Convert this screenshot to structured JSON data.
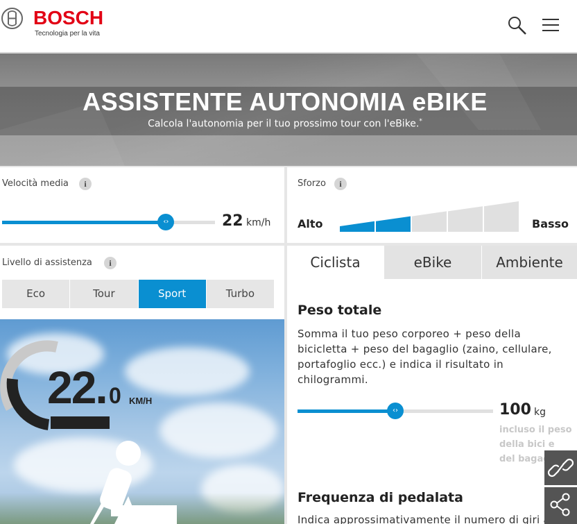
{
  "header": {
    "brand": "BOSCH",
    "tagline": "Tecnologia per la vita",
    "search_icon": "search-icon",
    "menu_icon": "menu-icon"
  },
  "hero": {
    "title": "ASSISTENTE AUTONOMIA eBIKE",
    "subtitle": "Calcola l'autonomia per il tuo prossimo tour con l'eBike.",
    "footnote_mark": "*"
  },
  "speed": {
    "label": "Velocità media",
    "value": "22",
    "unit": "km/h",
    "slider_fraction": 0.77
  },
  "effort": {
    "label": "Sforzo",
    "high_label": "Alto",
    "low_label": "Basso",
    "levels_total": 5,
    "levels_active": 2
  },
  "assistance": {
    "label": "Livello di assistenza",
    "options": [
      "Eco",
      "Tour",
      "Sport",
      "Turbo"
    ],
    "selected": "Sport"
  },
  "display": {
    "speed_int": "22.",
    "speed_dec": "0",
    "speed_unit": "KM/H"
  },
  "tabs": [
    {
      "label": "Ciclista",
      "active": true
    },
    {
      "label": "eBike",
      "active": false
    },
    {
      "label": "Ambiente",
      "active": false
    }
  ],
  "weight": {
    "title": "Peso totale",
    "desc_lines": [
      "Somma il tuo peso corporeo + peso della",
      "bicicletta + peso del bagaglio (zaino, cellulare,",
      "portafoglio ecc.) e indica il risultato in",
      "chilogrammi."
    ],
    "value": "100",
    "unit": "kg",
    "note_lines": [
      "incluso il peso",
      "della bici e",
      "del bagaglio"
    ],
    "slider_fraction": 0.5
  },
  "cadence": {
    "title": "Frequenza di pedalata",
    "desc": "Indica approssimativamente il numero di giri al"
  },
  "colors": {
    "accent": "#0a8fd1",
    "brand_red": "#e20015"
  }
}
